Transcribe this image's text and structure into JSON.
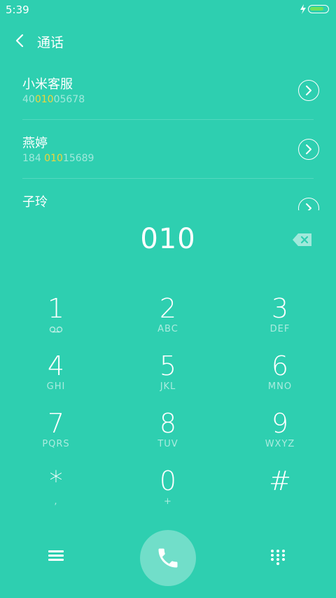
{
  "status": {
    "time": "5:39",
    "accent": "#2ECFB0",
    "battery_color": "#6FE15B"
  },
  "header": {
    "title": "通话"
  },
  "results": [
    {
      "name": "小米客服",
      "num_pre": "40",
      "num_hl": "010",
      "num_post": "05678"
    },
    {
      "name": "燕婷",
      "num_pre": "184 ",
      "num_hl": "010",
      "num_post": "15689"
    },
    {
      "name": "子玲",
      "num_pre": "",
      "num_hl": "",
      "num_post": ""
    }
  ],
  "dial_entry": "010",
  "keypad": [
    {
      "digit": "1",
      "letters": ""
    },
    {
      "digit": "2",
      "letters": "ABC"
    },
    {
      "digit": "3",
      "letters": "DEF"
    },
    {
      "digit": "4",
      "letters": "GHI"
    },
    {
      "digit": "5",
      "letters": "JKL"
    },
    {
      "digit": "6",
      "letters": "MNO"
    },
    {
      "digit": "7",
      "letters": "PQRS"
    },
    {
      "digit": "8",
      "letters": "TUV"
    },
    {
      "digit": "9",
      "letters": "WXYZ"
    },
    {
      "digit": "*",
      "letters": ","
    },
    {
      "digit": "0",
      "letters": "+"
    },
    {
      "digit": "#",
      "letters": ""
    }
  ],
  "highlight_color": "#F2D43A"
}
